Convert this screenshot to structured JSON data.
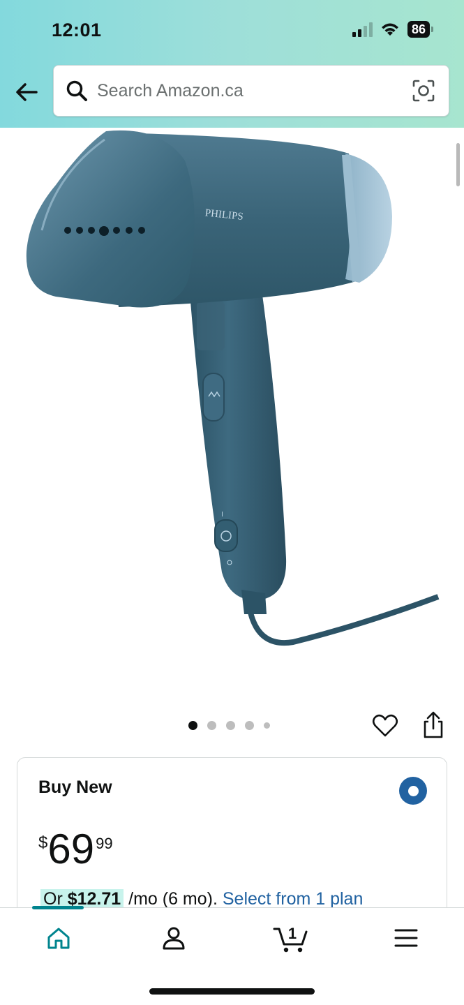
{
  "status_bar": {
    "time": "12:01",
    "battery": "86"
  },
  "header": {
    "search_placeholder": "Search Amazon.ca",
    "back_icon": "back-arrow-icon",
    "camera_icon": "camera-search-icon"
  },
  "product": {
    "image_brand_text": "PHILIPS",
    "image_count": 5,
    "active_image_index": 0
  },
  "buy_box": {
    "title": "Buy New",
    "price_symbol": "$",
    "price_whole": "69",
    "price_fraction": "99",
    "monthly_prefix": "Or ",
    "monthly_amount": "$12.71",
    "monthly_suffix": " /mo (6 mo). ",
    "monthly_link": "Select from 1 plan"
  },
  "bottom_nav": {
    "items": [
      "home-icon",
      "account-icon",
      "cart-icon",
      "menu-icon"
    ],
    "cart_count": "1",
    "accent_color": "#00848e"
  },
  "colors": {
    "link": "#2162a1",
    "header_gradient_start": "#83d9dd",
    "header_gradient_end": "#a7e5cf"
  }
}
